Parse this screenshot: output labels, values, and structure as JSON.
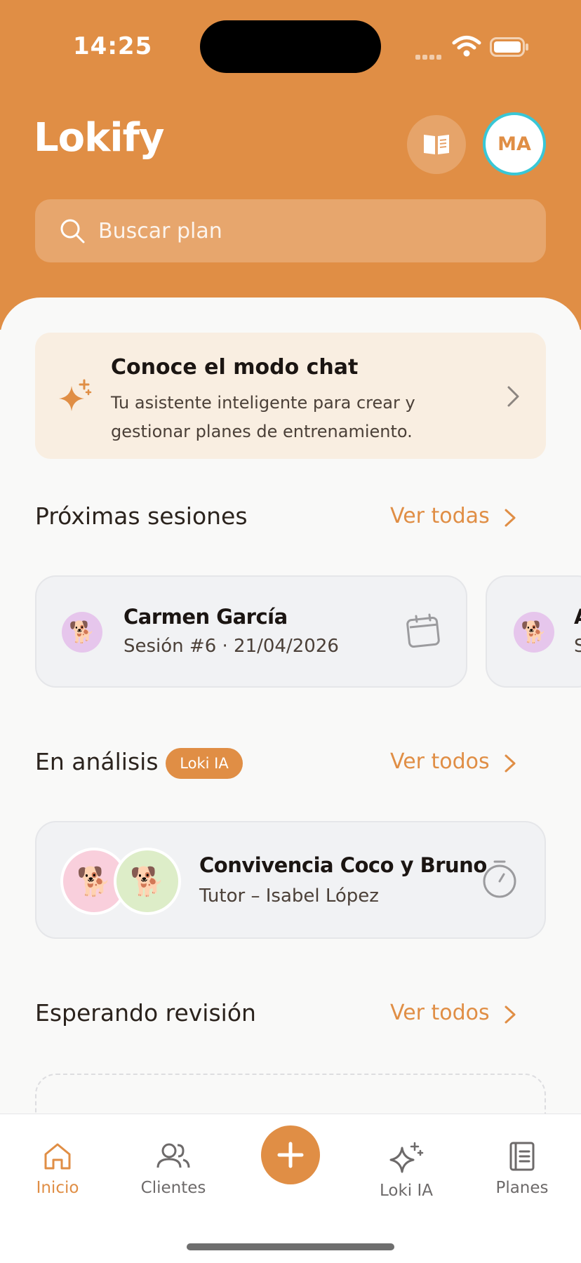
{
  "status_bar": {
    "time": "14:25"
  },
  "header": {
    "logo": "Lokify",
    "avatar_initials": "MA",
    "search_placeholder": "Buscar plan"
  },
  "promo": {
    "title": "Conoce el modo chat",
    "description": "Tu asistente inteligente para crear y gestionar planes de entrenamiento."
  },
  "upcoming": {
    "title": "Próximas sesiones",
    "see_all": "Ver todas",
    "cards": [
      {
        "name": "Carmen García",
        "detail": "Sesión #6 · 21/04/2026"
      },
      {
        "name": "A",
        "detail": "S"
      }
    ]
  },
  "analysis": {
    "title": "En análisis",
    "badge": "Loki IA",
    "see_all": "Ver todos",
    "card": {
      "name": "Convivencia Coco y Bruno",
      "detail": "Tutor – Isabel López"
    }
  },
  "review": {
    "title": "Esperando revisión",
    "see_all": "Ver todos"
  },
  "tabs": [
    {
      "label": "Inicio",
      "icon": "home-icon",
      "active": true
    },
    {
      "label": "Clientes",
      "icon": "users-icon",
      "active": false
    },
    {
      "label": "Loki IA",
      "icon": "sparkles-icon",
      "active": false
    },
    {
      "label": "Planes",
      "icon": "document-icon",
      "active": false
    }
  ],
  "colors": {
    "brand": "#E08E45",
    "avatar_ring": "#39C7D6",
    "promo_bg": "#F9EEE1",
    "pet_purple": "#E6C6EC",
    "pet_pink": "#F9CFDC",
    "pet_green": "#DDEDC8"
  },
  "icons": {
    "pet": "dog-emoji"
  }
}
